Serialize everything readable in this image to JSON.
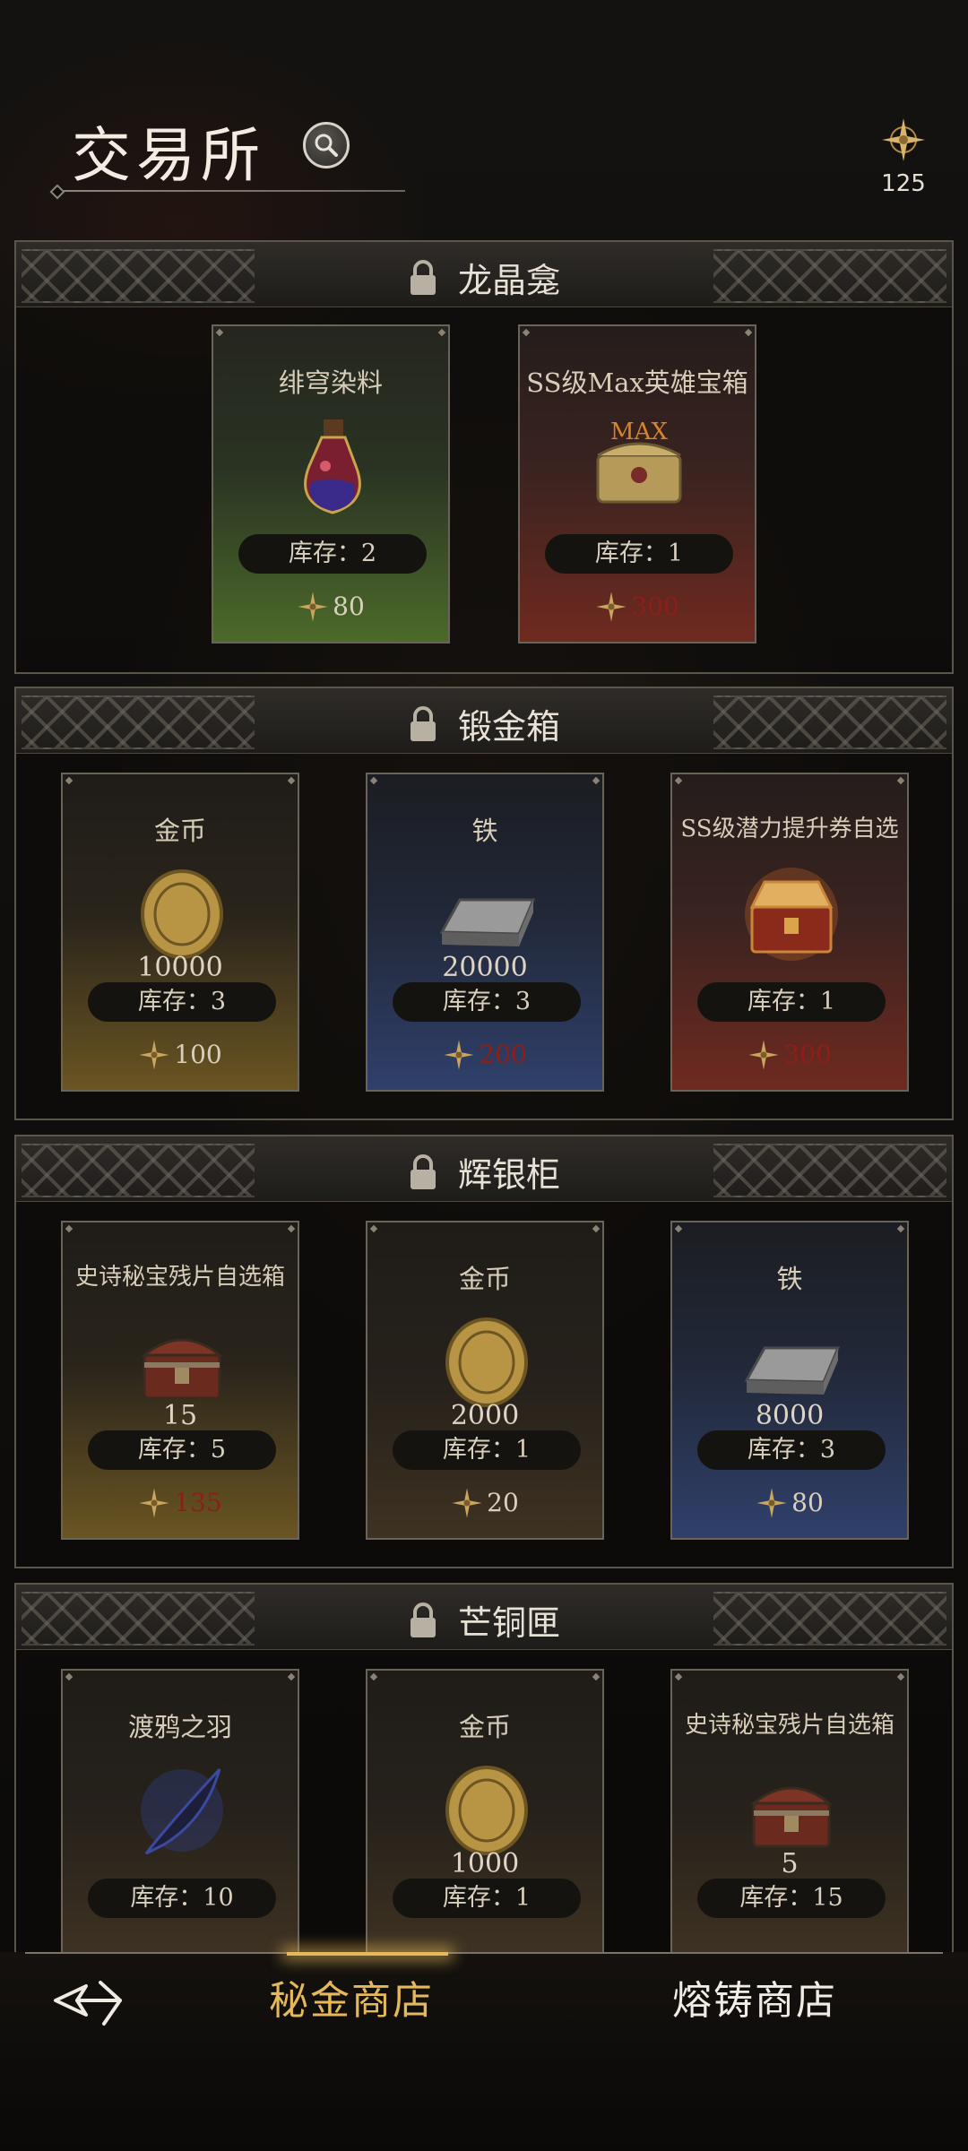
{
  "header": {
    "title": "交易所",
    "currency_amount": "125"
  },
  "sections": [
    {
      "title": "龙晶龛",
      "items": [
        {
          "name": "绯穹染料",
          "qty": "",
          "stock": "库存：2",
          "price": "80",
          "price_red": false
        },
        {
          "name": "SS级Max英雄宝箱",
          "qty": "",
          "stock": "库存：1",
          "price": "300",
          "price_red": true,
          "badge": "MAX"
        }
      ]
    },
    {
      "title": "锻金箱",
      "items": [
        {
          "name": "金币",
          "qty": "10000",
          "stock": "库存：3",
          "price": "100",
          "price_red": false
        },
        {
          "name": "铁",
          "qty": "20000",
          "stock": "库存：3",
          "price": "200",
          "price_red": true
        },
        {
          "name": "SS级潜力提升券自选",
          "qty": "",
          "stock": "库存：1",
          "price": "300",
          "price_red": true
        }
      ]
    },
    {
      "title": "辉银柜",
      "items": [
        {
          "name": "史诗秘宝残片自选箱",
          "qty": "15",
          "stock": "库存：5",
          "price": "135",
          "price_red": true
        },
        {
          "name": "金币",
          "qty": "2000",
          "stock": "库存：1",
          "price": "20",
          "price_red": false
        },
        {
          "name": "铁",
          "qty": "8000",
          "stock": "库存：3",
          "price": "80",
          "price_red": false
        }
      ]
    },
    {
      "title": "芒铜匣",
      "items": [
        {
          "name": "渡鸦之羽",
          "qty": "",
          "stock": "库存：10",
          "price": "",
          "price_red": false
        },
        {
          "name": "金币",
          "qty": "1000",
          "stock": "库存：1",
          "price": "",
          "price_red": false
        },
        {
          "name": "史诗秘宝残片自选箱",
          "qty": "5",
          "stock": "库存：15",
          "price": "",
          "price_red": false
        }
      ]
    }
  ],
  "nav": {
    "tab_active": "秘金商店",
    "tab_inactive": "熔铸商店"
  },
  "colors": {
    "accent_gold": "#e5b85a",
    "price_red": "#8c1f1a"
  },
  "icons": [
    "search-icon",
    "compass-star-icon",
    "lock-icon",
    "back-arrow-icon"
  ]
}
